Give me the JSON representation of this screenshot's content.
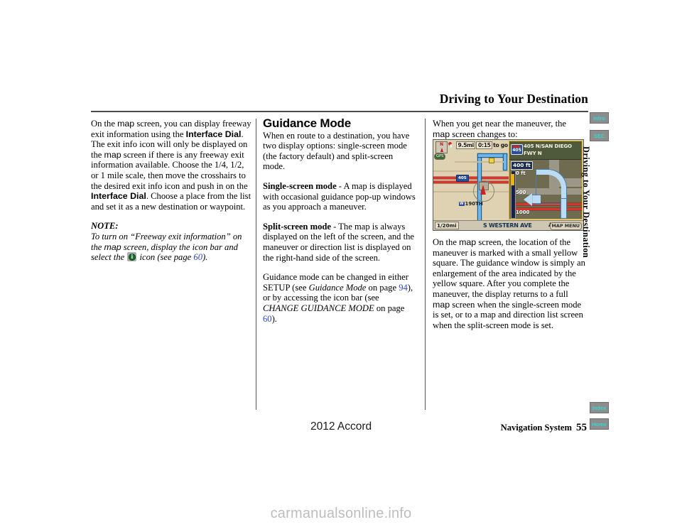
{
  "header": {
    "chapter_title": "Driving to Your Destination"
  },
  "sidebar": {
    "tabs": [
      {
        "label": "Intro",
        "name": "intro"
      },
      {
        "label": "SEC",
        "name": "sec"
      },
      {
        "label": "Index",
        "name": "index"
      },
      {
        "label": "Home",
        "name": "home"
      }
    ],
    "chapter_label": "Driving to Your Destination"
  },
  "column1": {
    "para1_a": "On the ",
    "para1_map1": "map",
    "para1_b": " screen, you can display freeway exit information using the ",
    "para1_term1": "Interface Dial",
    "para1_c": ". The exit info icon will only be displayed on the ",
    "para1_map2": "map",
    "para1_d": " screen if there is any freeway exit information available. Choose the 1/4, 1/2, or 1 mile scale, then move the crosshairs to the desired exit info icon and push in on the ",
    "para1_term2": "Interface Dial",
    "para1_e": ". Choose a place from the list and set it as a new destination or waypoint.",
    "note_heading": "NOTE:",
    "note_a": "To turn on “Freeway exit information” on the ",
    "note_map": "map",
    "note_b": " screen, display the icon bar and select the ",
    "note_c": " icon (see page ",
    "note_page": "60",
    "note_d": ").",
    "info_icon_name": "info-icon"
  },
  "column2": {
    "heading": "Guidance Mode",
    "para1": "When en route to a destination, you have two display options: single-screen mode (the factory default) and split-screen mode.",
    "single_label": "Single-screen mode",
    "single_text": " - A map is displayed with occasional guidance pop-up windows as you approach a maneuver.",
    "split_label": "Split-screen mode",
    "split_text": " - The map is always displayed on the left of the screen, and the maneuver or direction list is displayed on the right-hand side of the screen.",
    "para_setup_a": "Guidance mode can be changed in either SETUP (see ",
    "para_setup_ital1": "Guidance Mode",
    "para_setup_b": " on page ",
    "para_setup_page1": "94",
    "para_setup_c": "), or by accessing the icon bar (see ",
    "para_setup_ital2": "CHANGE GUIDANCE MODE",
    "para_setup_d": " on page ",
    "para_setup_page2": "60",
    "para_setup_e": ")."
  },
  "column3": {
    "para1_a": "When you get near the maneuver, the ",
    "para1_map": "map",
    "para1_b": " screen changes to:",
    "para2_a": "On the ",
    "para2_map1": "map",
    "para2_b": " screen, the location of the maneuver is marked with a small yellow square. The guidance window is simply an enlargement of the area indicated by the yellow square. After you complete the maneuver, the display returns to a full ",
    "para2_map2": "map",
    "para2_c": " screen when the single-screen mode is set, or to a map and direction list screen when the split-screen mode is set."
  },
  "nav_screenshot": {
    "compass_label": "N",
    "gps_label": "GPS",
    "eta_distance": "9.5mi",
    "eta_time": "0:15",
    "eta_suffix": "to go",
    "map_shield": "405",
    "map_street": "190TH",
    "map_street_prefix": "W",
    "guidance_shield": "405",
    "guidance_highway": "405 N/SAN DIEGO FWY N",
    "distance_to_turn": "400 ft",
    "scale_0": "0 ft",
    "scale_500": "500",
    "scale_1000": "1000",
    "map_scale": "1/20mi",
    "current_street": "S WESTERN AVE",
    "map_menu_label": "MAP MENU"
  },
  "footer": {
    "model": "2012 Accord",
    "manual_name": "Navigation System",
    "page_number": "55"
  },
  "watermark": "carmanualsonline.info",
  "colors": {
    "tab_background": "#8d8d8d",
    "tab_text": "#2fd8d2",
    "page_link": "#2a47c8",
    "rule": "#4a4a4a"
  }
}
